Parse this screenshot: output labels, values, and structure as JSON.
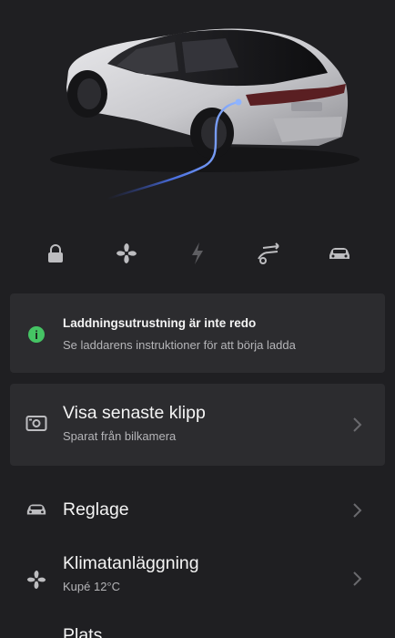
{
  "colors": {
    "background": "#1f1f22",
    "card": "#2c2c2f",
    "accent_green": "#45c464",
    "cable_blue": "#5a8dff"
  },
  "quick_controls": [
    {
      "icon": "lock-icon"
    },
    {
      "icon": "fan-icon"
    },
    {
      "icon": "lightning-icon"
    },
    {
      "icon": "trunk-icon"
    },
    {
      "icon": "car-icon"
    }
  ],
  "alert": {
    "icon": "info-icon",
    "icon_glyph": "i",
    "title": "Laddningsutrustning är inte redo",
    "subtitle": "Se laddarens instruktioner för att börja ladda"
  },
  "dashcam": {
    "icon": "camera-icon",
    "title": "Visa senaste klipp",
    "subtitle": "Sparat från bilkamera"
  },
  "menu": [
    {
      "icon": "car-icon",
      "title": "Reglage",
      "subtitle": ""
    },
    {
      "icon": "fan-icon",
      "title": "Klimatanläggning",
      "subtitle": "Kupé 12°C"
    },
    {
      "icon": "location-icon",
      "title": "Plats",
      "subtitle": ""
    }
  ]
}
